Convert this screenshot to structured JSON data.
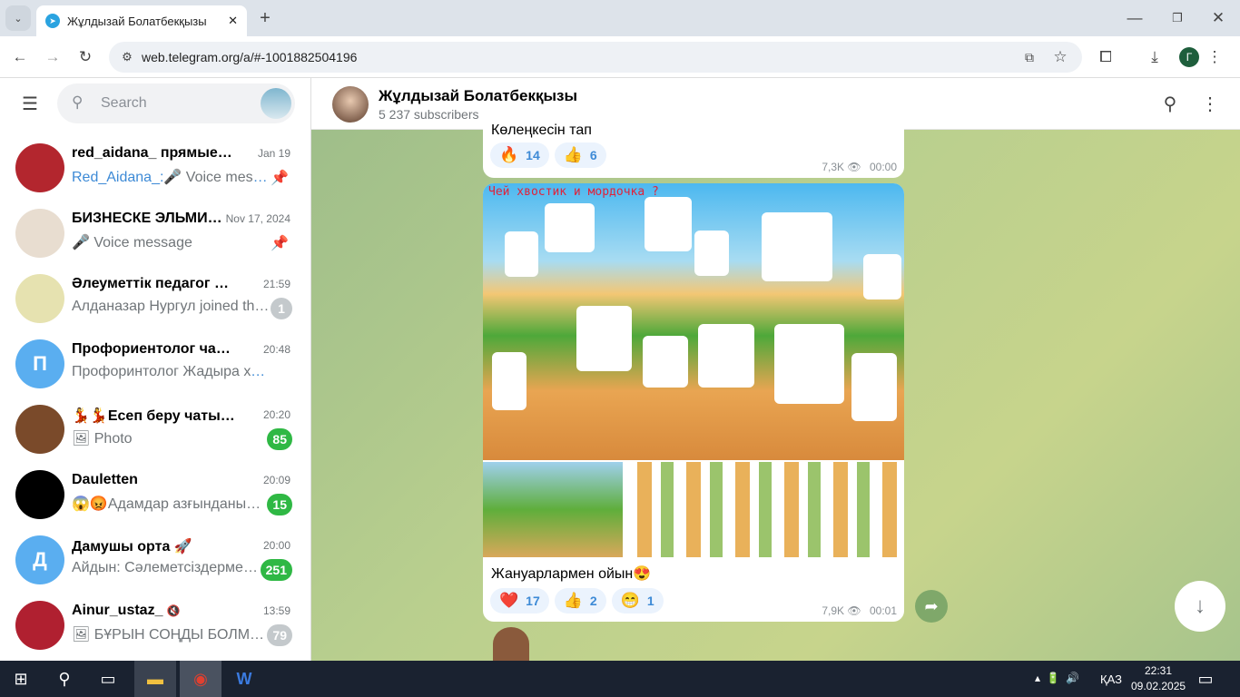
{
  "browser": {
    "tab_title": "Жұлдызай Болатбекқызы",
    "url": "web.telegram.org/a/#-1001882504196",
    "profile_initial": "Г"
  },
  "sidebar": {
    "search_placeholder": "Search",
    "chats": [
      {
        "name": "red_aidana_ прямые …",
        "time": "Jan 19",
        "sender": "Red_Aidana_:",
        "preview": "🎤 Voice mess…",
        "muted": true,
        "pinned": true
      },
      {
        "name": "БИЗНЕСКЕ ЭЛЬМИ…",
        "time": "Nov 17, 2024",
        "preview": "🎤 Voice message",
        "pinned": true
      },
      {
        "name": "Әлеуметтік педагог РК",
        "time": "21:59",
        "preview": "Алданазар Нургул joined th…",
        "muted": true,
        "badge": "1"
      },
      {
        "name": "Профориентолог чат “Фо…",
        "time": "20:48",
        "preview": "Профоринтолог Жадыра хан…",
        "avatar_letter": "П"
      },
      {
        "name": "💃💃Есеп беру чаты 💃…",
        "time": "20:20",
        "preview": "🖼 Photo",
        "badge": "85"
      },
      {
        "name": "Dauletten",
        "time": "20:09",
        "preview": "😱😡Адамдар азғынданы…",
        "badge": "15"
      },
      {
        "name": "Дамушы орта 🚀",
        "time": "20:00",
        "preview": "Айдын: Сәлеметсіздерме…",
        "avatar_letter": "Д",
        "badge": "251"
      },
      {
        "name": "Ainur_ustaz_",
        "time": "13:59",
        "preview": "🖼 БҰРЫН СОҢДЫ БОЛМ…",
        "muted": true,
        "badge": "79"
      }
    ]
  },
  "channel": {
    "name": "Жұлдызай Болатбекқызы",
    "subscribers": "5 237 subscribers"
  },
  "posts": [
    {
      "caption": "Көлеңкесін тап",
      "reactions": [
        {
          "emoji": "🔥",
          "count": "14"
        },
        {
          "emoji": "👍",
          "count": "6"
        }
      ],
      "views": "7,3K",
      "time": "00:00"
    },
    {
      "image_title": "Чей хвостик и мордочка ?",
      "caption": "Жануарлармен ойын😍",
      "reactions": [
        {
          "emoji": "❤️",
          "count": "17"
        },
        {
          "emoji": "👍",
          "count": "2"
        },
        {
          "emoji": "😁",
          "count": "1"
        }
      ],
      "views": "7,9K",
      "time": "00:01"
    }
  ],
  "taskbar": {
    "lang": "ҚАЗ",
    "time": "22:31",
    "date": "09.02.2025"
  }
}
